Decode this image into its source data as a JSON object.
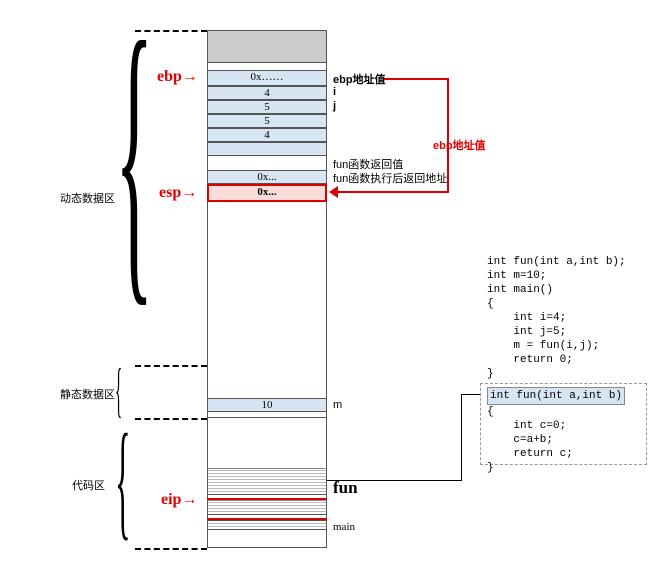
{
  "regions": {
    "dynamic": "动态数据区",
    "static": "静态数据区",
    "code": "代码区"
  },
  "pointers": {
    "ebp": "ebp",
    "esp": "esp",
    "eip": "eip"
  },
  "arrows": {
    "right": "→"
  },
  "cells": {
    "c0": "0x……",
    "c1": "4",
    "c2": "5",
    "c3": "5",
    "c4": "4",
    "c5": "0x...",
    "c6": "0x...",
    "c7": "10"
  },
  "labels": {
    "l0": "ebp地址值",
    "l1": "i",
    "l2": "j",
    "l3": "fun函数返回值",
    "l4": "fun函数执行后返回地址",
    "l5": "m",
    "funBig": "fun",
    "mainSmall": "main",
    "ebpArrow": "ebp地址值"
  },
  "code": {
    "main": "int fun(int a,int b);\nint m=10;\nint main()\n{\n    int i=4;\n    int j=5;\n    m = fun(i,j);\n    return 0;\n}",
    "funDecl": "int fun(int a,int b)",
    "funBody": "{\n    int c=0;\n    c=a+b;\n    return c;\n}"
  }
}
